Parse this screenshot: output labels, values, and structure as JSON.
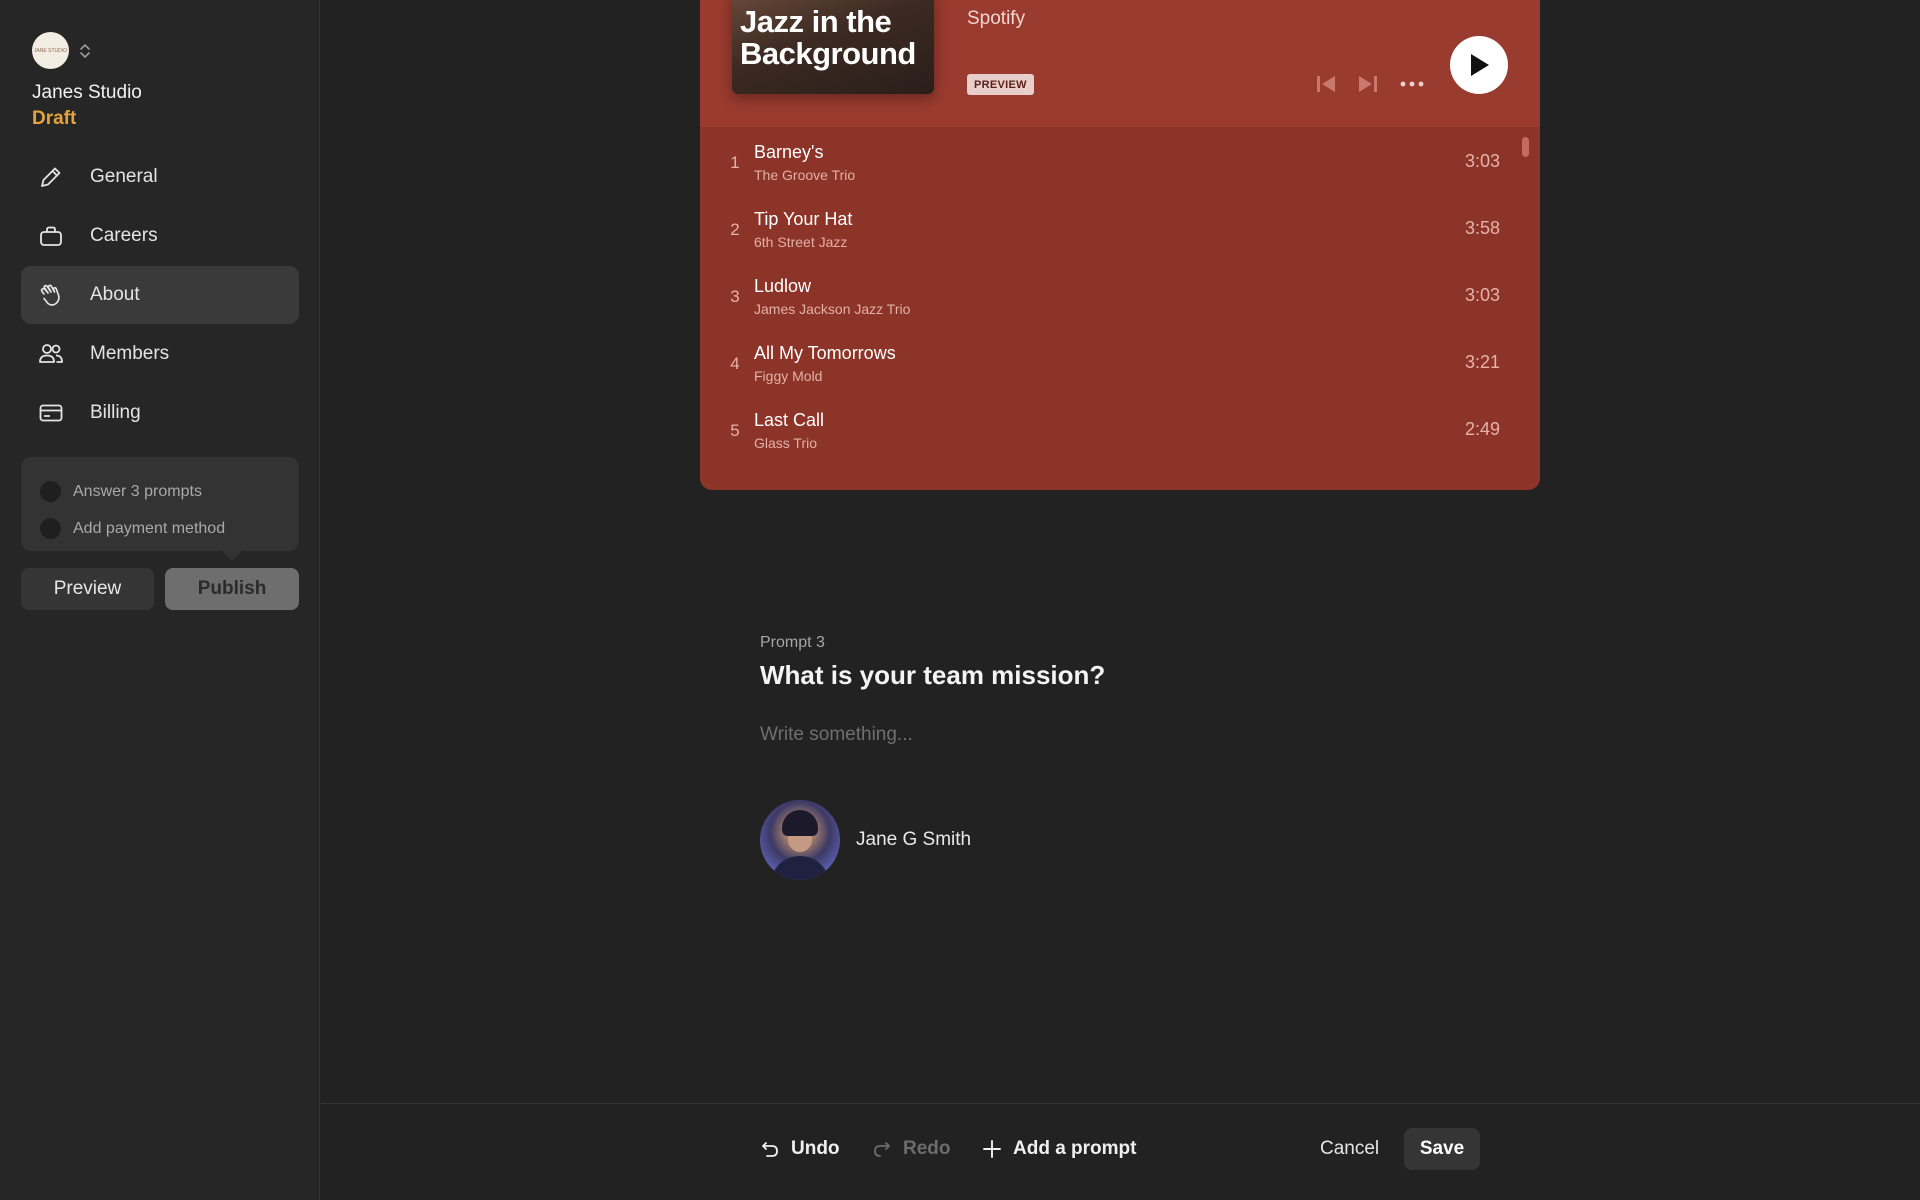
{
  "sidebar": {
    "logo_text": "JANE STUDIO",
    "studio_name": "Janes Studio",
    "status": "Draft",
    "nav": [
      {
        "label": "General",
        "icon": "pencil-icon"
      },
      {
        "label": "Careers",
        "icon": "briefcase-icon"
      },
      {
        "label": "About",
        "icon": "waving-hand-icon",
        "active": true
      },
      {
        "label": "Members",
        "icon": "users-icon"
      },
      {
        "label": "Billing",
        "icon": "credit-card-icon"
      }
    ],
    "checklist": [
      {
        "label": "Answer 3 prompts"
      },
      {
        "label": "Add payment method"
      }
    ],
    "preview_label": "Preview",
    "publish_label": "Publish"
  },
  "playlist": {
    "cover_title": "Jazz in the Background",
    "provider": "Spotify",
    "preview_tag": "PREVIEW",
    "accent_color": "#9a3b2f",
    "tracks": [
      {
        "num": "1",
        "title": "Barney's",
        "artist": "The Groove Trio",
        "duration": "3:03"
      },
      {
        "num": "2",
        "title": "Tip Your Hat",
        "artist": "6th Street Jazz",
        "duration": "3:58"
      },
      {
        "num": "3",
        "title": "Ludlow",
        "artist": "James Jackson Jazz Trio",
        "duration": "3:03"
      },
      {
        "num": "4",
        "title": "All My Tomorrows",
        "artist": "Figgy Mold",
        "duration": "3:21"
      },
      {
        "num": "5",
        "title": "Last Call",
        "artist": "Glass Trio",
        "duration": "2:49"
      }
    ]
  },
  "prompt": {
    "label": "Prompt 3",
    "question": "What is your team mission?",
    "placeholder": "Write something...",
    "value": "",
    "author": "Jane G Smith"
  },
  "toolbar": {
    "undo": "Undo",
    "redo": "Redo",
    "add_prompt": "Add a prompt",
    "cancel": "Cancel",
    "save": "Save"
  },
  "colors": {
    "background": "#222222",
    "sidebar": "#262626",
    "draft": "#e6a33a",
    "card": "#8d3428"
  }
}
